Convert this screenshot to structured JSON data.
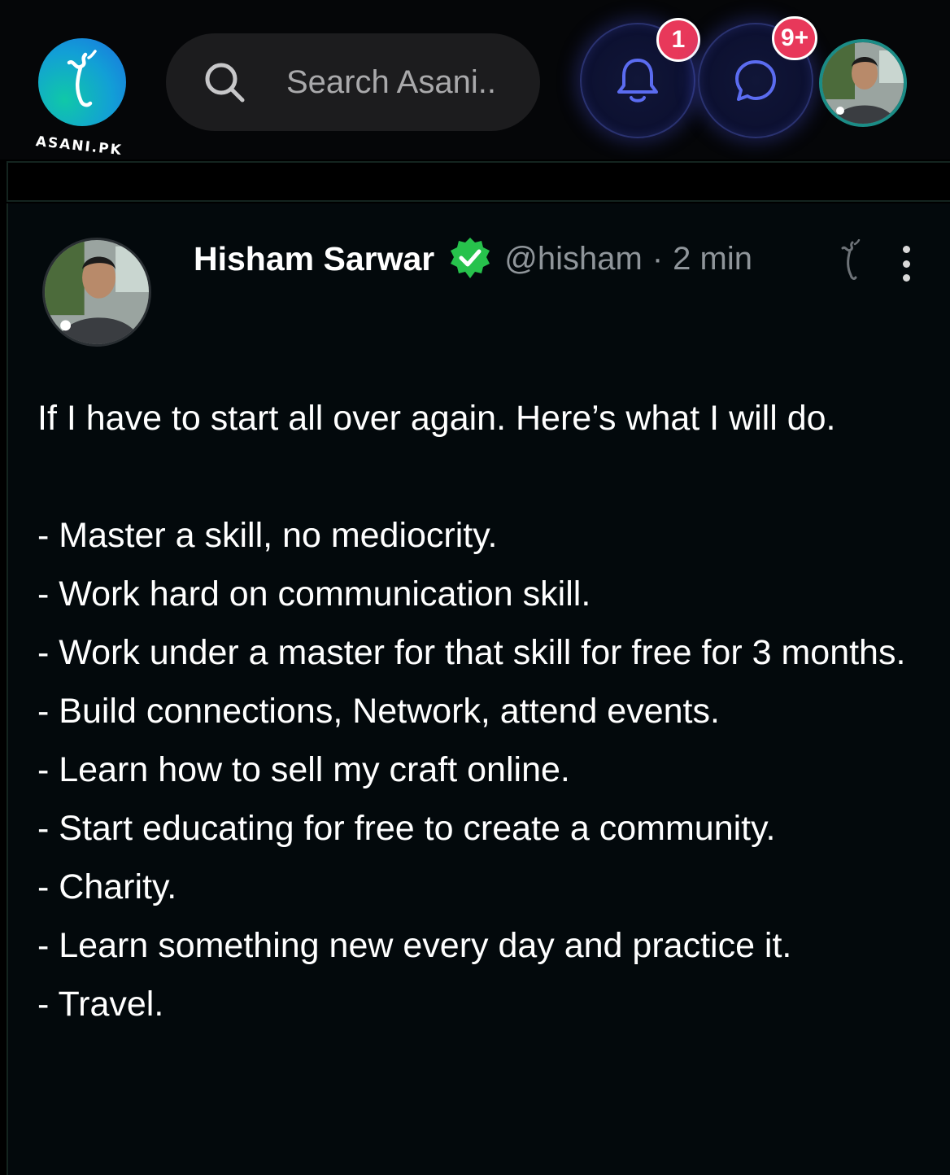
{
  "header": {
    "logo_text": "ASANI.PK",
    "search": {
      "placeholder": "Search Asani.."
    },
    "notifications": {
      "badge": "1"
    },
    "messages": {
      "badge": "9+"
    }
  },
  "post": {
    "author_name": "Hisham Sarwar",
    "handle": "@hisham",
    "separator": "·",
    "time": "2 min",
    "intro_lines": [
      "If I have to start all over again. Here’s what I will do."
    ],
    "list_items": [
      "- Master a skill, no mediocrity.",
      "- Work hard on communication skill.",
      "- Work under a master for that skill for free for 3 months.",
      "- Build connections, Network, attend events.",
      "- Learn how to sell my craft online.",
      "- Start educating for free to create a community.",
      "- Charity.",
      "- Learn something new every day and practice it.",
      "- Travel."
    ]
  },
  "icons": {
    "logo": "asani-logo-icon",
    "search": "search-icon",
    "notifications": "bell-icon",
    "messages": "chat-bubble-icon",
    "verified": "verified-badge-icon",
    "more": "more-vertical-icon"
  },
  "colors": {
    "background": "#000000",
    "post_background": "#03090c",
    "badge": "#e8385a",
    "verified": "#27c24c",
    "muted_text": "#8f959a",
    "icon_button_glow": "#3d48c8"
  }
}
